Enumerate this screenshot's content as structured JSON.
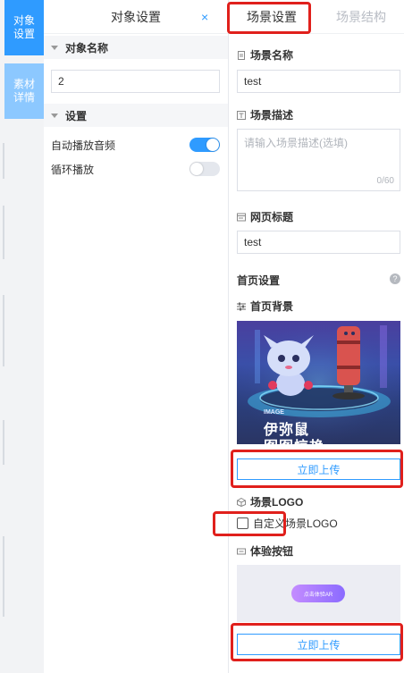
{
  "left_tabs": [
    {
      "label": "对象设置"
    },
    {
      "label": "素材详情"
    }
  ],
  "object_panel": {
    "title": "对象设置",
    "close": "×",
    "section_name": {
      "label": "对象名称",
      "value": "2"
    },
    "section_settings": {
      "label": "设置"
    },
    "settings": [
      {
        "label": "自动播放音频",
        "on": true
      },
      {
        "label": "循环播放",
        "on": false
      }
    ]
  },
  "scene_tabs": {
    "active": "场景设置",
    "inactive": "场景结构"
  },
  "scene": {
    "name_label": "场景名称",
    "name_value": "test",
    "desc_label": "场景描述",
    "desc_placeholder": "请输入场景描述(选填)",
    "desc_counter": "0/60",
    "page_title_label": "网页标题",
    "page_title_value": "test",
    "home_settings_label": "首页设置",
    "help_icon": "?",
    "home_bg_label": "首页背景",
    "home_bg_text_1": "IMAGE",
    "home_bg_text_2": "伊弥鼠",
    "home_bg_text_3": "图图惊艳",
    "upload_label": "立即上传",
    "logo_label": "场景LOGO",
    "custom_checkbox_label": "自定义",
    "custom_checkbox_suffix": "场景LOGO",
    "custom_checked": false,
    "experience_btn_label": "体验按钮",
    "experience_btn_preview": "点击体验AR",
    "upload_label_2": "立即上传"
  },
  "colors": {
    "accent": "#2f9bff",
    "accent_light": "#8cc8ff",
    "highlight_red": "#e0201c",
    "switch_off": "#e4e7ed"
  }
}
